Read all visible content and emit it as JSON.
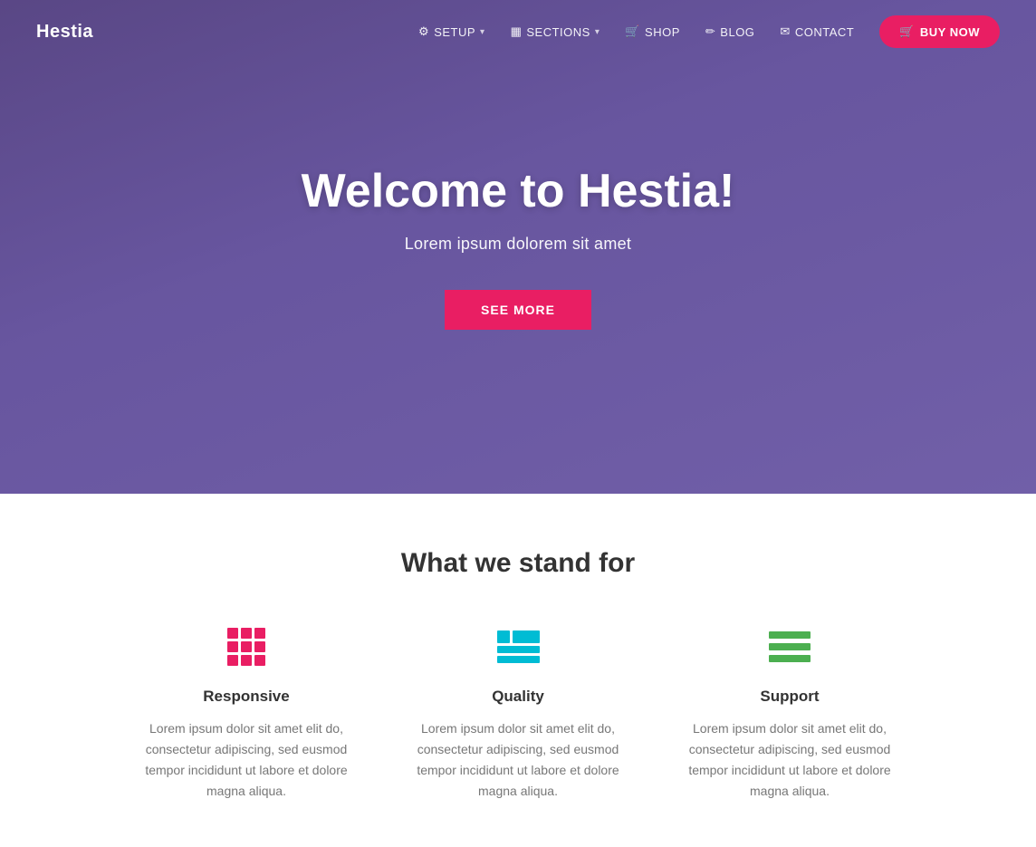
{
  "brand": "Hestia",
  "nav": {
    "links": [
      {
        "id": "setup",
        "label": "SETUP",
        "icon": "⚙",
        "hasDropdown": true
      },
      {
        "id": "sections",
        "label": "SECTIONS",
        "icon": "▦",
        "hasDropdown": true
      },
      {
        "id": "shop",
        "label": "SHOP",
        "icon": "🛒",
        "hasDropdown": false
      },
      {
        "id": "blog",
        "label": "BLOG",
        "icon": "✏",
        "hasDropdown": false
      },
      {
        "id": "contact",
        "label": "CONTACT",
        "icon": "✉",
        "hasDropdown": false
      }
    ],
    "buy_button": "BUY NOW"
  },
  "hero": {
    "title": "Welcome to Hestia!",
    "subtitle": "Lorem ipsum dolorem sit amet",
    "cta": "SEE MORE"
  },
  "features": {
    "section_title": "What we stand for",
    "items": [
      {
        "id": "responsive",
        "name": "Responsive",
        "description": "Lorem ipsum dolor sit amet elit do, consectetur adipiscing, sed eusmod tempor incididunt ut labore et dolore magna aliqua."
      },
      {
        "id": "quality",
        "name": "Quality",
        "description": "Lorem ipsum dolor sit amet elit do, consectetur adipiscing, sed eusmod tempor incididunt ut labore et dolore magna aliqua."
      },
      {
        "id": "support",
        "name": "Support",
        "description": "Lorem ipsum dolor sit amet elit do, consectetur adipiscing, sed eusmod tempor incididunt ut labore et dolore magna aliqua."
      }
    ]
  }
}
